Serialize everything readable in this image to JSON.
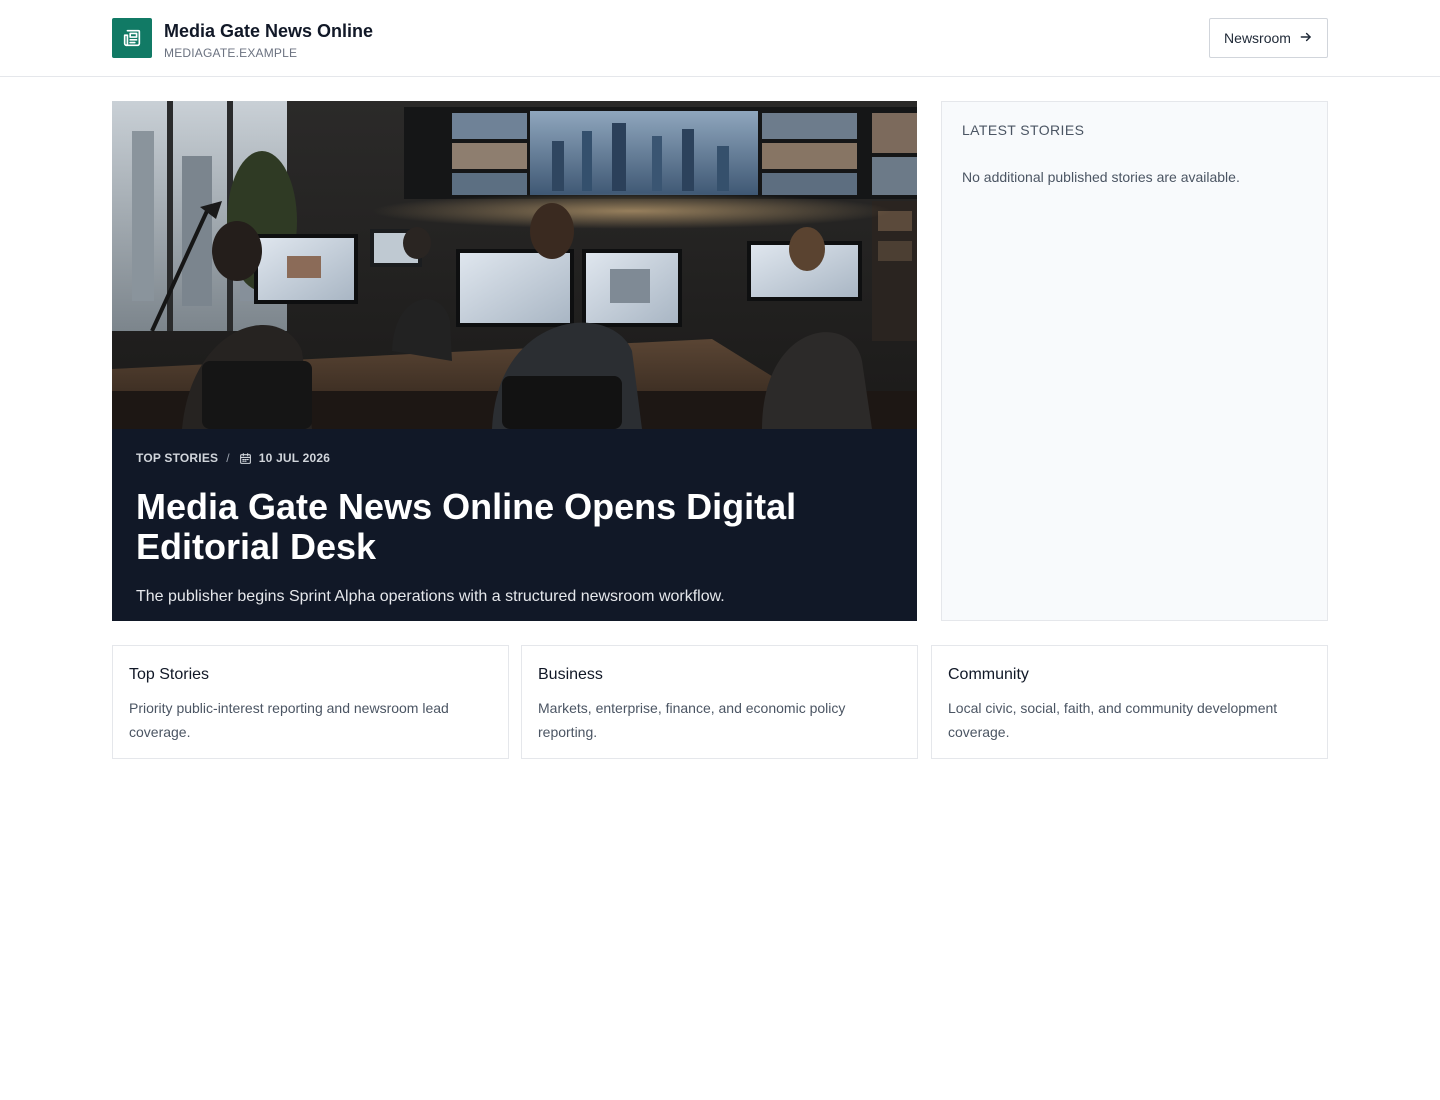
{
  "header": {
    "site_name": "Media Gate News Online",
    "domain": "MEDIAGATE.EXAMPLE",
    "logo_icon": "newspaper-icon",
    "newsroom_button": {
      "label": "Newsroom",
      "icon": "arrow-right-icon"
    }
  },
  "hero": {
    "image_description": "newsroom-office-photo",
    "category": "TOP STORIES",
    "separator": "/",
    "date_icon": "calendar-icon",
    "date": "10 JUL 2026",
    "title": "Media Gate News Online Opens Digital Editorial Desk",
    "summary": "The publisher begins Sprint Alpha operations with a structured newsroom workflow."
  },
  "sidebar": {
    "title": "LATEST STORIES",
    "empty_message": "No additional published stories are available."
  },
  "categories": [
    {
      "title": "Top Stories",
      "description": "Priority public-interest reporting and newsroom lead coverage."
    },
    {
      "title": "Business",
      "description": "Markets, enterprise, finance, and economic policy reporting."
    },
    {
      "title": "Community",
      "description": "Local civic, social, faith, and community development coverage."
    }
  ],
  "colors": {
    "brand": "#117a65",
    "hero_background": "#111827",
    "sidebar_background": "#f8fafc",
    "border": "#e5e7eb"
  }
}
